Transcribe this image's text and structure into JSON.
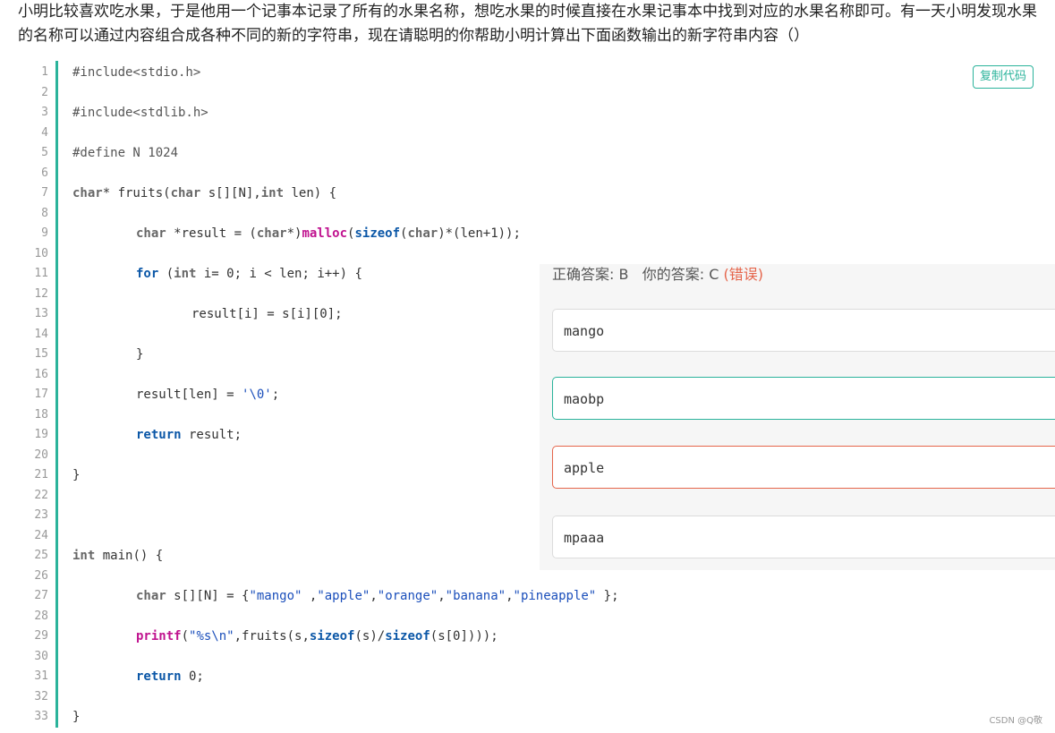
{
  "question": "小明比较喜欢吃水果，于是他用一个记事本记录了所有的水果名称，想吃水果的时候直接在水果记事本中找到对应的水果名称即可。有一天小明发现水果的名称可以通过内容组合成各种不同的新的字符串，现在请聪明的你帮助小明计算出下面函数输出的新字符串内容（）",
  "copy_label": "复制代码",
  "line_numbers": [
    "1",
    "2",
    "3",
    "4",
    "5",
    "6",
    "7",
    "8",
    "9",
    "10",
    "11",
    "12",
    "13",
    "14",
    "15",
    "16",
    "17",
    "18",
    "19",
    "20",
    "21",
    "22",
    "23",
    "24",
    "25",
    "26",
    "27",
    "28",
    "29",
    "30",
    "31",
    "32",
    "33"
  ],
  "code": {
    "l1": "#include<stdio.h>",
    "l3": "#include<stdlib.h>",
    "l5": "#define N 1024",
    "l7_a": "char",
    "l7_b": "* fruits(",
    "l7_c": "char",
    "l7_d": " s[][N],",
    "l7_e": "int",
    "l7_f": " len) {",
    "l9_a": "char",
    "l9_b": " *result = (",
    "l9_c": "char",
    "l9_d": "*)",
    "l9_e": "malloc",
    "l9_f": "(",
    "l9_g": "sizeof",
    "l9_h": "(",
    "l9_i": "char",
    "l9_j": ")*(len+1));",
    "l11_a": "for",
    "l11_b": " (",
    "l11_c": "int",
    "l11_d": " i= 0; i < len; i++) {",
    "l13": "result[i] = s[i][0];",
    "l15": "}",
    "l17_a": "result[len] = ",
    "l17_b": "'\\0'",
    "l17_c": ";",
    "l19_a": "return",
    "l19_b": " result;",
    "l21": "}",
    "l25_a": "int",
    "l25_b": " main() {",
    "l27_a": "char",
    "l27_b": " s[][N] = {",
    "l27_c": "\"mango\"",
    "l27_d": " ,",
    "l27_e": "\"apple\"",
    "l27_f": ",",
    "l27_g": "\"orange\"",
    "l27_h": ",",
    "l27_i": "\"banana\"",
    "l27_j": ",",
    "l27_k": "\"pineapple\"",
    "l27_l": " };",
    "l29_a": "printf",
    "l29_b": "(",
    "l29_c": "\"%s\\n\"",
    "l29_d": ",fruits(s,",
    "l29_e": "sizeof",
    "l29_f": "(s)/",
    "l29_g": "sizeof",
    "l29_h": "(s[0])));",
    "l31_a": "return",
    "l31_b": " 0;",
    "l33": "}"
  },
  "answer": {
    "correct_label": "正确答案: B",
    "your_label": "你的答案: C",
    "wrong_label": "(错误)",
    "options": [
      {
        "text": "mango",
        "state": "normal"
      },
      {
        "text": "maobp",
        "state": "correct"
      },
      {
        "text": "apple",
        "state": "wrong"
      },
      {
        "text": "mpaaa",
        "state": "normal"
      }
    ]
  },
  "colors": {
    "accent": "#2bb39b",
    "error": "#e5654b"
  },
  "watermark": "CSDN @Q敬"
}
